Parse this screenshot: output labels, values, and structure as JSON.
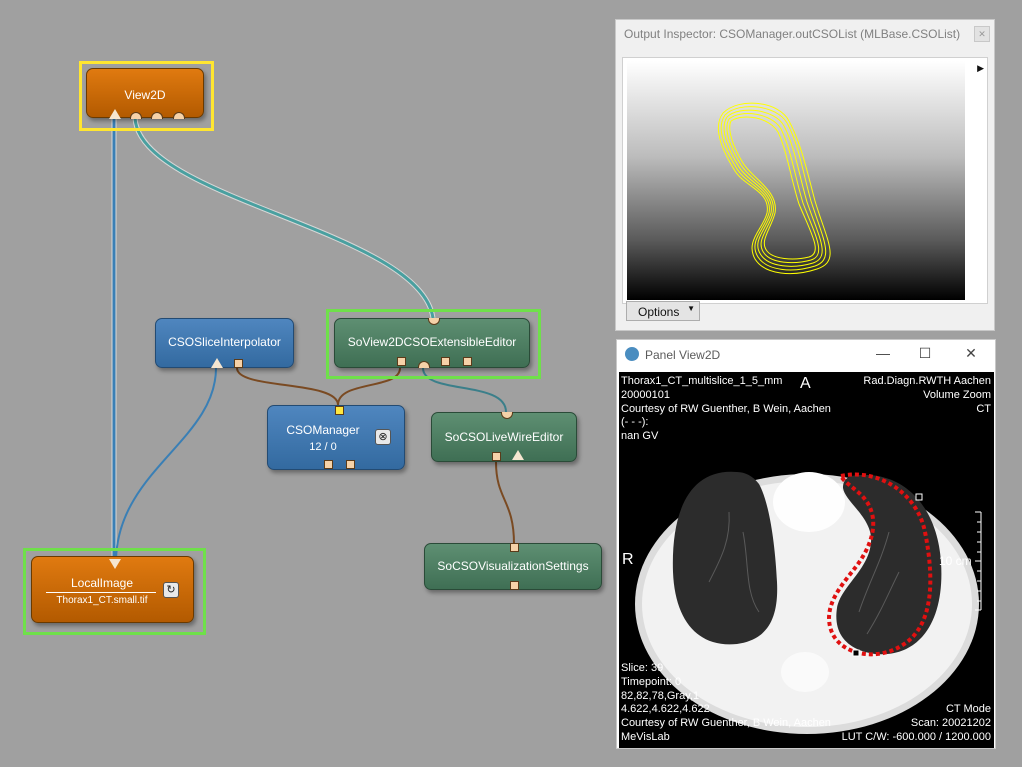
{
  "network": {
    "nodes": {
      "view2d": {
        "title": "View2D"
      },
      "cso_slice_interpolator": {
        "title": "CSOSliceInterpolator"
      },
      "soview2d_editor": {
        "title": "SoView2DCSOExtensibleEditor"
      },
      "cso_manager": {
        "title": "CSOManager",
        "subtitle": "12 / 0",
        "button_icon": "clear-icon"
      },
      "live_wire_editor": {
        "title": "SoCSOLiveWireEditor"
      },
      "vis_settings": {
        "title": "SoCSOVisualizationSettings"
      },
      "local_image": {
        "title": "LocalImage",
        "subtitle": "Thorax1_CT.small.tif",
        "button_icon": "reload-icon"
      }
    },
    "colors": {
      "image_connection": "#3a7fb5",
      "inventor_connection": "#4aa0a0",
      "base_connection": "#7a4a22",
      "selection_yellow": "#ffe630",
      "selection_green": "#6fe04a"
    }
  },
  "output_inspector": {
    "title": "Output Inspector: CSOManager.outCSOList (MLBase.CSOList)",
    "options_label": "Options",
    "contour_color": "#ffff00"
  },
  "panel_view2d": {
    "title": "Panel View2D",
    "overlay": {
      "top_left": [
        "Thorax1_CT_multislice_1_5_mm",
        "20000101",
        "Courtesy of RW Guenther, B Wein, Aachen",
        "(- - -):",
        "nan GV"
      ],
      "top_right": [
        "Rad.Diagn.RWTH Aachen",
        "Volume Zoom",
        "CT"
      ],
      "orientation_top": "A",
      "orientation_left": "R",
      "scale_label": "10 cm",
      "bottom_left": [
        "Slice: 39",
        "Timepoint: 0",
        "82,82,78,Gray,1",
        "4.622,4.622,4.622",
        "Courtesy of RW Guenther, B Wein, Aachen",
        "MeVisLab"
      ],
      "bottom_right": [
        "CT Mode",
        "Scan: 20021202",
        "LUT C/W: -600.000 / 1200.000"
      ]
    },
    "contour_color": "#e01010"
  }
}
